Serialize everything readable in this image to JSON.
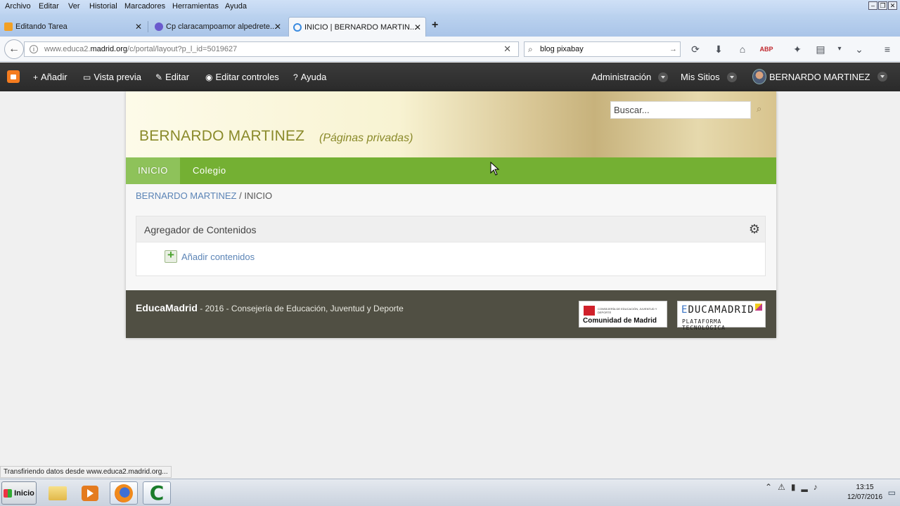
{
  "menubar": {
    "items": [
      {
        "label": "Archivo"
      },
      {
        "label": "Editar"
      },
      {
        "label": "Ver"
      },
      {
        "label": "Historial"
      },
      {
        "label": "Marcadores"
      },
      {
        "label": "Herramientas"
      },
      {
        "label": "Ayuda"
      }
    ]
  },
  "tabs": [
    {
      "label": "Editando Tarea",
      "favicon_color": "#f2a024"
    },
    {
      "label": "Cp claracampoamor alpedrete...",
      "favicon_color": "#6a5acd"
    },
    {
      "label": "INICIO | BERNARDO MARTIN...",
      "favicon_color": "#3a8be0"
    }
  ],
  "address": {
    "prefix": "www.educa2.",
    "domain": "madrid.org",
    "path": "/c/portal/layout?p_l_id=5019627"
  },
  "search": {
    "value": "blog pixabay"
  },
  "dockbar": {
    "add": "Añadir",
    "preview": "Vista previa",
    "edit": "Editar",
    "edit_controls": "Editar controles",
    "help": "Ayuda",
    "admin": "Administración",
    "my_sites": "Mis Sitios",
    "user": "BERNARDO MARTINEZ"
  },
  "portal": {
    "title": "BERNARDO MARTINEZ",
    "subtitle": "(Páginas privadas)",
    "search_placeholder": "Buscar...",
    "nav": {
      "inicio": "INICIO",
      "colegio": "Colegio"
    },
    "breadcrumb": {
      "link": "BERNARDO MARTINEZ",
      "sep": "/",
      "current": "INICIO"
    },
    "portlet": {
      "title": "Agregador de Contenidos",
      "add_link": "Añadir contenidos"
    },
    "footer": {
      "brand": "EducaMadrid",
      "text": " - 2016 - Consejería de Educación, Juventud y Deporte",
      "logo_cm_small": "CONSEJERÍA DE EDUCACIÓN, JUVENTUD Y DEPORTE",
      "logo_cm_big": "Comunidad de Madrid",
      "logo_em_e": "E",
      "logo_em_rest": "DUCAMADRID",
      "logo_em_small": "PLATAFORMA TECNOLÓGICA"
    }
  },
  "statusbar": {
    "text": "Transfiriendo datos desde www.educa2.madrid.org..."
  },
  "taskbar": {
    "start": "Inicio",
    "time": "13:15",
    "date": "12/07/2016"
  },
  "colors": {
    "accent_green": "#74b033",
    "dock_dark": "#2f2f2f",
    "footer": "#504f43",
    "title_olive": "#8a8a2a",
    "link_blue": "#5b84b6"
  }
}
